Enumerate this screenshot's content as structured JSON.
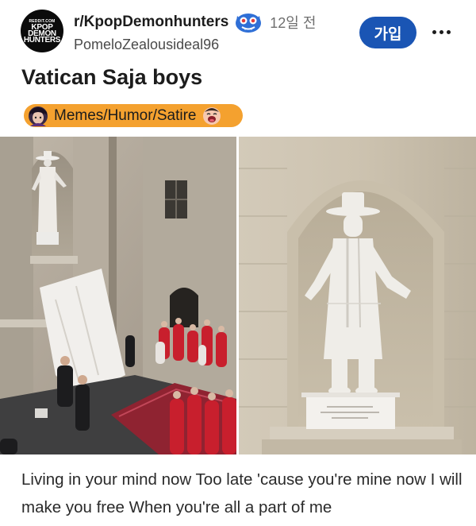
{
  "post": {
    "subreddit": "r/KpopDemonhunters",
    "time": "12일 전",
    "username": "PomeloZealousideal96",
    "join_label": "가입",
    "title": "Vatican Saja boys",
    "flair": "Memes/Humor/Satire",
    "body": "Living in your mind now Too late 'cause you're mine now I will make you free When you're all a part of me"
  },
  "avatar": {
    "line1": "REDDIT.COM",
    "line2": "KPOP",
    "line3": "DEMON",
    "line4": "HUNTERS"
  },
  "colors": {
    "join_button": "#1a55b4",
    "flair_background": "#f4a12f",
    "text_primary": "#1c1c1c",
    "text_secondary": "#6f6f6f"
  },
  "icons": {
    "community": "blue-demon-tiger-icon",
    "flair_left": "character-avatar-icon",
    "flair_right": "laughing-face-icon",
    "more": "more-options-icon"
  }
}
